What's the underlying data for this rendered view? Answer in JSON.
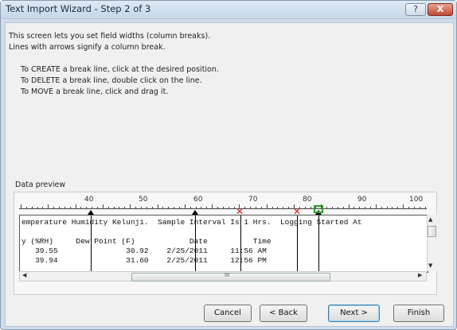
{
  "window": {
    "title": "Text Import Wizard - Step 2 of 3",
    "help_label": "?",
    "close_label": "X"
  },
  "intro": {
    "line1": "This screen lets you set field widths (column breaks).",
    "line2": "Lines with arrows signify a column break.",
    "create": "To CREATE a break line, click at the desired position.",
    "delete": "To DELETE a break line, double click on the line.",
    "move": "To MOVE a break line, click and drag it."
  },
  "preview": {
    "label": "Data preview",
    "ruler_numbers": [
      "40",
      "50",
      "60",
      "70",
      "80",
      "90",
      "100"
    ],
    "rows": [
      "emperature Humidity Kelunji.  Sample Interval Is 1 Hrs.  Logging Started At",
      "",
      "y (%RH)     Dew Point (F)            Date          Time",
      "   39.55               30.92    2/25/2011     11:56 AM",
      "   39.94               31.60    2/25/2011     12:56 PM"
    ],
    "scroll_grip": "III"
  },
  "buttons": {
    "cancel": "Cancel",
    "back": "< Back",
    "next": "Next >",
    "finish": "Finish"
  },
  "scrollbar_arrows": {
    "up": "▲",
    "down": "▼",
    "left": "◀",
    "right": "▶"
  }
}
